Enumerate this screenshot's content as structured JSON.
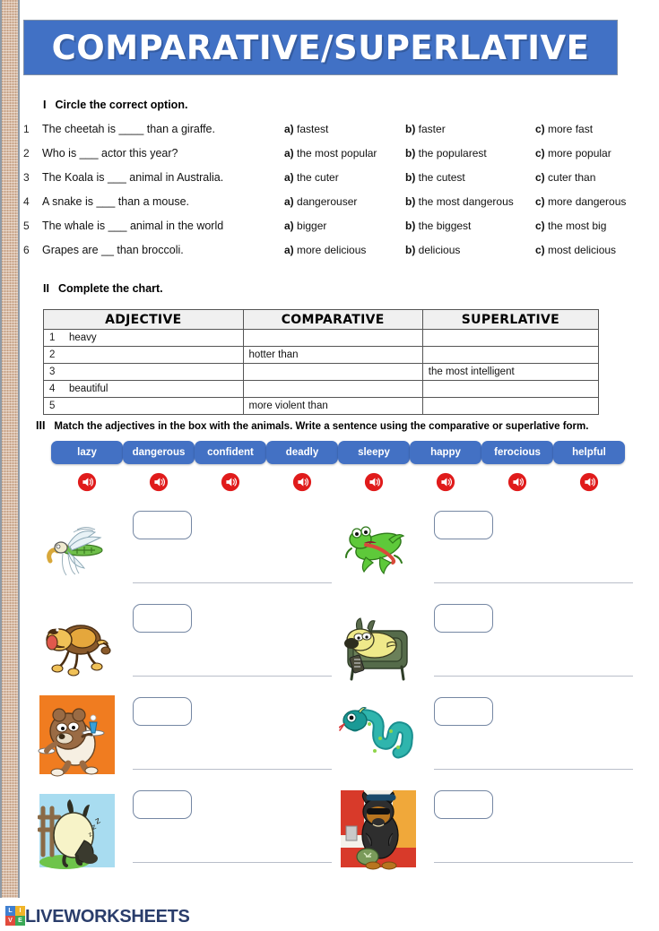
{
  "page": {
    "title": "COMPARATIVE/SUPERLATIVE"
  },
  "exercise1": {
    "number": "I",
    "instruction": "Circle the correct option.",
    "questions": [
      {
        "no": "1",
        "text": "The cheetah is ____ than a giraffe.",
        "a": "fastest",
        "b": "faster",
        "c": "more fast"
      },
      {
        "no": "2",
        "text": "Who is ___ actor this year?",
        "a": "the most popular",
        "b": "the popularest",
        "c": "more popular"
      },
      {
        "no": "3",
        "text": "The Koala is ___ animal in Australia.",
        "a": "the cuter",
        "b": "the cutest",
        "c": "cuter than"
      },
      {
        "no": "4",
        "text": "A snake is ___ than a mouse.",
        "a": "dangerouser",
        "b": "the most dangerous",
        "c": "more dangerous"
      },
      {
        "no": "5",
        "text": "The whale is ___ animal in the world",
        "a": "bigger",
        "b": "the biggest",
        "c": "the most big"
      },
      {
        "no": "6",
        "text": "Grapes are __ than broccoli.",
        "a": "more delicious",
        "b": "delicious",
        "c": "most delicious"
      }
    ],
    "labels": {
      "a": "a)",
      "b": "b)",
      "c": "c)"
    }
  },
  "exercise2": {
    "number": "II",
    "instruction": "Complete the chart.",
    "headers": [
      "ADJECTIVE",
      "COMPARATIVE",
      "SUPERLATIVE"
    ],
    "rows": [
      {
        "no": "1",
        "adjective": "heavy",
        "comparative": "",
        "superlative": ""
      },
      {
        "no": "2",
        "adjective": "",
        "comparative": "hotter than",
        "superlative": ""
      },
      {
        "no": "3",
        "adjective": "",
        "comparative": "",
        "superlative": "the most intelligent"
      },
      {
        "no": "4",
        "adjective": "beautiful",
        "comparative": "",
        "superlative": ""
      },
      {
        "no": "5",
        "adjective": "",
        "comparative": "more violent than",
        "superlative": ""
      }
    ]
  },
  "exercise3": {
    "number": "III",
    "instruction": "Match the adjectives in the box with the animals. Write a sentence using the comparative or superlative form.",
    "words": [
      "lazy",
      "dangerous",
      "confident",
      "deadly",
      "sleepy",
      "happy",
      "ferocious",
      "helpful"
    ],
    "audio_icon": "speaker-icon",
    "animals": [
      {
        "name": "dragonfly",
        "answer": "",
        "sentence": ""
      },
      {
        "name": "frog",
        "answer": "",
        "sentence": ""
      },
      {
        "name": "lion",
        "answer": "",
        "sentence": ""
      },
      {
        "name": "dog-on-couch",
        "answer": "",
        "sentence": ""
      },
      {
        "name": "bear-waiter",
        "answer": "",
        "sentence": ""
      },
      {
        "name": "snake",
        "answer": "",
        "sentence": ""
      },
      {
        "name": "sheep-sleeping",
        "answer": "",
        "sentence": ""
      },
      {
        "name": "guard-dog",
        "answer": "",
        "sentence": ""
      }
    ]
  },
  "footer": {
    "brand": "LIVEWORKSHEETS",
    "tiles": [
      "L",
      "I",
      "V",
      "E"
    ]
  },
  "colors": {
    "banner_blue": "#4171c5",
    "button_blue": "#4371c4",
    "speaker_red": "#e01b1b",
    "binding_tan": "#d9bba4"
  }
}
